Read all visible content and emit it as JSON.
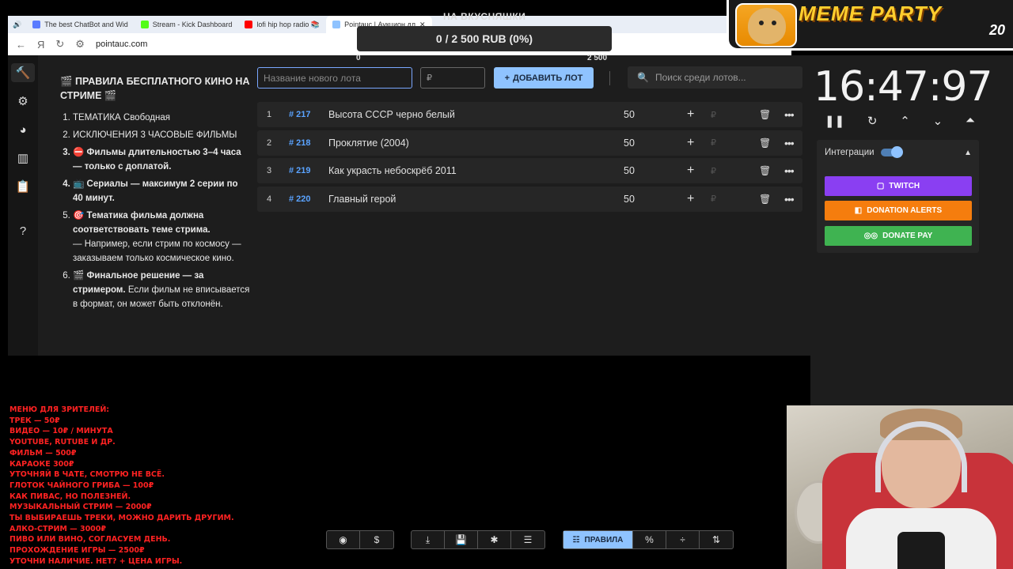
{
  "browser": {
    "tabs": [
      {
        "label": "The best ChatBot and Wid",
        "color": "#5b7cff"
      },
      {
        "label": "Stream - Kick Dashboard",
        "color": "#53fc18"
      },
      {
        "label": "lofi hip hop radio 📚",
        "color": "#ff0000"
      },
      {
        "label": "Pointauc | Аукцион дл",
        "color": "#8fc3ff"
      }
    ],
    "url": "pointauc.com"
  },
  "overlay": {
    "title": "НА ВКУСНЯШКИ",
    "progress_text": "0 / 2 500 RUB (0%)",
    "min": "0",
    "max": "2 500",
    "progress": 0
  },
  "meme": {
    "title": "MEME PARTY",
    "number": "20"
  },
  "rules": {
    "title": "🎬 ПРАВИЛА БЕСПЛАТНОГО КИНО НА СТРИМЕ 🎬",
    "items": [
      "ТЕМАТИКА Свободная",
      "ИСКЛЮЧЕНИЯ  3 ЧАСОВЫЕ ФИЛЬМЫ",
      "⛔ Фильмы длительностью 3–4 часа — только с доплатой.",
      "📺 Сериалы — максимум 2 серии по 40 минут.",
      "🎯 Тематика фильма должна соответствовать теме стрима.",
      "🎬 Финальное решение — за стримером."
    ],
    "item5_extra": "— Например, если стрим по космосу — заказываем только космическое кино.",
    "item6_extra": "Если фильм не вписывается в формат, он может быть отклонён."
  },
  "form": {
    "lot_placeholder": "Название нового лота",
    "price_placeholder": "₽",
    "add_label": "ДОБАВИТЬ ЛОТ",
    "search_placeholder": "Поиск среди лотов..."
  },
  "lots": [
    {
      "idx": "1",
      "num": "# 217",
      "name": "Высота СССР черно белый",
      "amount": "50"
    },
    {
      "idx": "2",
      "num": "# 218",
      "name": "Проклятие (2004)",
      "amount": "50"
    },
    {
      "idx": "3",
      "num": "# 219",
      "name": "Как украсть небоскрёб 2011",
      "amount": "50"
    },
    {
      "idx": "4",
      "num": "# 220",
      "name": "Главный герой",
      "amount": "50"
    }
  ],
  "timer": {
    "value": "16:47:97"
  },
  "integrations": {
    "label": "Интеграции",
    "twitch": "TWITCH",
    "donation_alerts": "DONATION ALERTS",
    "donate_pay": "DONATE PAY"
  },
  "menu_lines": [
    "МЕНЮ ДЛЯ ЗРИТЕЛЕЙ:",
    " ТРЕК — 50₽",
    "ВИДЕО — 10₽ / МИНУТА",
    "YOUTUBE, RUTUBE И ДР.",
    " ФИЛЬМ — 500₽",
    "КАРАОКЕ 300₽",
    "УТОЧНЯЙ В ЧАТЕ, СМОТРЮ НЕ ВСЁ.",
    " ГЛОТОК ЧАЙНОГО ГРИБА — 100₽",
    "КАК ПИВАС, НО ПОЛЕЗНЕЙ.",
    "МУЗЫКАЛЬНЫЙ СТРИМ — 2000₽",
    "ТЫ ВЫБИРАЕШЬ ТРЕКИ, МОЖНО ДАРИТЬ ДРУГИМ.",
    " АЛКО-СТРИМ — 3000₽",
    "ПИВО ИЛИ ВИНО, СОГЛАСУЕМ ДЕНЬ.",
    " ПРОХОЖДЕНИЕ ИГРЫ — 2500₽",
    "УТОЧНИ НАЛИЧИЕ. НЕТ? + ЦЕНА ИГРЫ."
  ],
  "toolbar": {
    "rules_label": "ПРАВИЛА"
  },
  "colors": {
    "accent": "#8fc3ff",
    "twitch": "#8a3ff2",
    "donation_alerts": "#f57d0e",
    "donate_pay": "#3fb351",
    "lot_number": "#5aa3ff"
  }
}
